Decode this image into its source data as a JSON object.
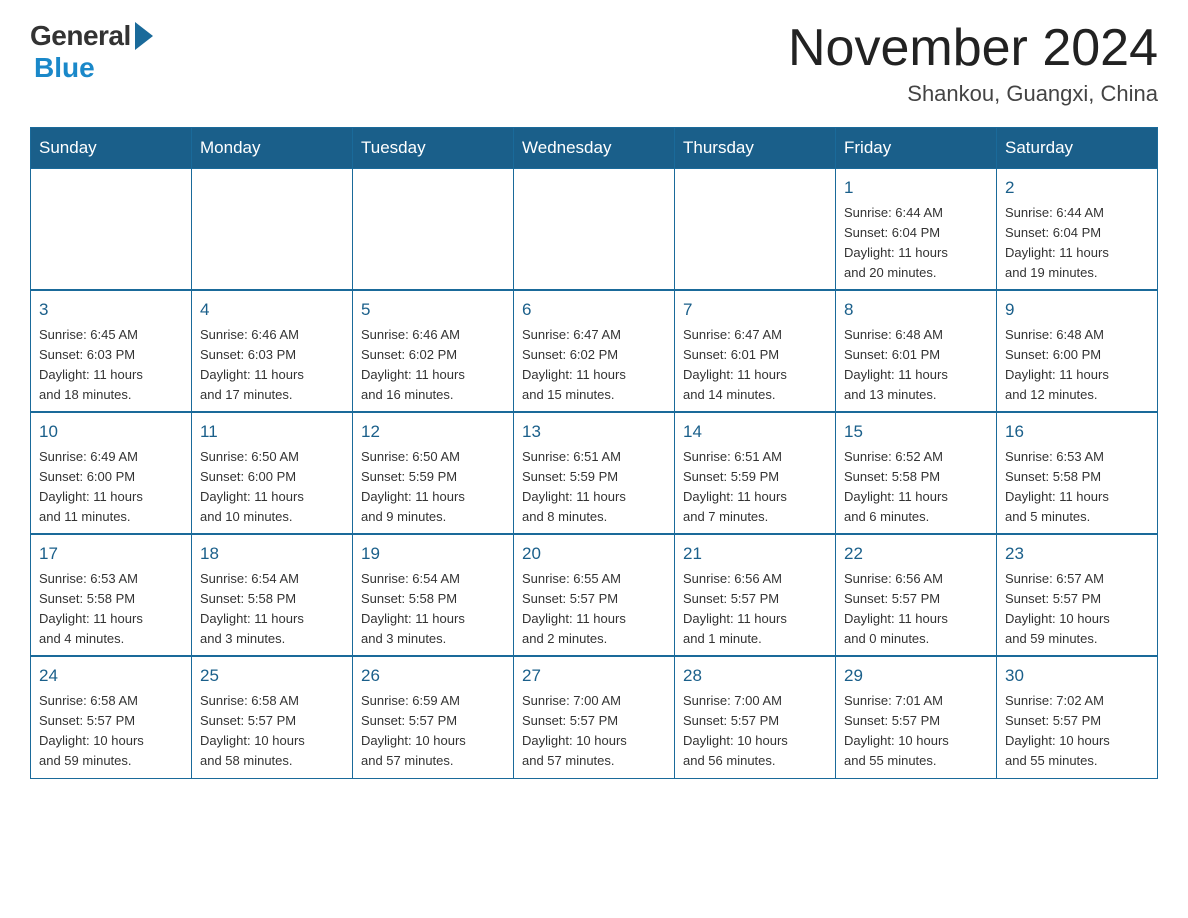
{
  "header": {
    "logo_general": "General",
    "logo_blue": "Blue",
    "title": "November 2024",
    "location": "Shankou, Guangxi, China"
  },
  "days_of_week": [
    "Sunday",
    "Monday",
    "Tuesday",
    "Wednesday",
    "Thursday",
    "Friday",
    "Saturday"
  ],
  "weeks": [
    [
      {
        "day": "",
        "info": ""
      },
      {
        "day": "",
        "info": ""
      },
      {
        "day": "",
        "info": ""
      },
      {
        "day": "",
        "info": ""
      },
      {
        "day": "",
        "info": ""
      },
      {
        "day": "1",
        "info": "Sunrise: 6:44 AM\nSunset: 6:04 PM\nDaylight: 11 hours\nand 20 minutes."
      },
      {
        "day": "2",
        "info": "Sunrise: 6:44 AM\nSunset: 6:04 PM\nDaylight: 11 hours\nand 19 minutes."
      }
    ],
    [
      {
        "day": "3",
        "info": "Sunrise: 6:45 AM\nSunset: 6:03 PM\nDaylight: 11 hours\nand 18 minutes."
      },
      {
        "day": "4",
        "info": "Sunrise: 6:46 AM\nSunset: 6:03 PM\nDaylight: 11 hours\nand 17 minutes."
      },
      {
        "day": "5",
        "info": "Sunrise: 6:46 AM\nSunset: 6:02 PM\nDaylight: 11 hours\nand 16 minutes."
      },
      {
        "day": "6",
        "info": "Sunrise: 6:47 AM\nSunset: 6:02 PM\nDaylight: 11 hours\nand 15 minutes."
      },
      {
        "day": "7",
        "info": "Sunrise: 6:47 AM\nSunset: 6:01 PM\nDaylight: 11 hours\nand 14 minutes."
      },
      {
        "day": "8",
        "info": "Sunrise: 6:48 AM\nSunset: 6:01 PM\nDaylight: 11 hours\nand 13 minutes."
      },
      {
        "day": "9",
        "info": "Sunrise: 6:48 AM\nSunset: 6:00 PM\nDaylight: 11 hours\nand 12 minutes."
      }
    ],
    [
      {
        "day": "10",
        "info": "Sunrise: 6:49 AM\nSunset: 6:00 PM\nDaylight: 11 hours\nand 11 minutes."
      },
      {
        "day": "11",
        "info": "Sunrise: 6:50 AM\nSunset: 6:00 PM\nDaylight: 11 hours\nand 10 minutes."
      },
      {
        "day": "12",
        "info": "Sunrise: 6:50 AM\nSunset: 5:59 PM\nDaylight: 11 hours\nand 9 minutes."
      },
      {
        "day": "13",
        "info": "Sunrise: 6:51 AM\nSunset: 5:59 PM\nDaylight: 11 hours\nand 8 minutes."
      },
      {
        "day": "14",
        "info": "Sunrise: 6:51 AM\nSunset: 5:59 PM\nDaylight: 11 hours\nand 7 minutes."
      },
      {
        "day": "15",
        "info": "Sunrise: 6:52 AM\nSunset: 5:58 PM\nDaylight: 11 hours\nand 6 minutes."
      },
      {
        "day": "16",
        "info": "Sunrise: 6:53 AM\nSunset: 5:58 PM\nDaylight: 11 hours\nand 5 minutes."
      }
    ],
    [
      {
        "day": "17",
        "info": "Sunrise: 6:53 AM\nSunset: 5:58 PM\nDaylight: 11 hours\nand 4 minutes."
      },
      {
        "day": "18",
        "info": "Sunrise: 6:54 AM\nSunset: 5:58 PM\nDaylight: 11 hours\nand 3 minutes."
      },
      {
        "day": "19",
        "info": "Sunrise: 6:54 AM\nSunset: 5:58 PM\nDaylight: 11 hours\nand 3 minutes."
      },
      {
        "day": "20",
        "info": "Sunrise: 6:55 AM\nSunset: 5:57 PM\nDaylight: 11 hours\nand 2 minutes."
      },
      {
        "day": "21",
        "info": "Sunrise: 6:56 AM\nSunset: 5:57 PM\nDaylight: 11 hours\nand 1 minute."
      },
      {
        "day": "22",
        "info": "Sunrise: 6:56 AM\nSunset: 5:57 PM\nDaylight: 11 hours\nand 0 minutes."
      },
      {
        "day": "23",
        "info": "Sunrise: 6:57 AM\nSunset: 5:57 PM\nDaylight: 10 hours\nand 59 minutes."
      }
    ],
    [
      {
        "day": "24",
        "info": "Sunrise: 6:58 AM\nSunset: 5:57 PM\nDaylight: 10 hours\nand 59 minutes."
      },
      {
        "day": "25",
        "info": "Sunrise: 6:58 AM\nSunset: 5:57 PM\nDaylight: 10 hours\nand 58 minutes."
      },
      {
        "day": "26",
        "info": "Sunrise: 6:59 AM\nSunset: 5:57 PM\nDaylight: 10 hours\nand 57 minutes."
      },
      {
        "day": "27",
        "info": "Sunrise: 7:00 AM\nSunset: 5:57 PM\nDaylight: 10 hours\nand 57 minutes."
      },
      {
        "day": "28",
        "info": "Sunrise: 7:00 AM\nSunset: 5:57 PM\nDaylight: 10 hours\nand 56 minutes."
      },
      {
        "day": "29",
        "info": "Sunrise: 7:01 AM\nSunset: 5:57 PM\nDaylight: 10 hours\nand 55 minutes."
      },
      {
        "day": "30",
        "info": "Sunrise: 7:02 AM\nSunset: 5:57 PM\nDaylight: 10 hours\nand 55 minutes."
      }
    ]
  ]
}
